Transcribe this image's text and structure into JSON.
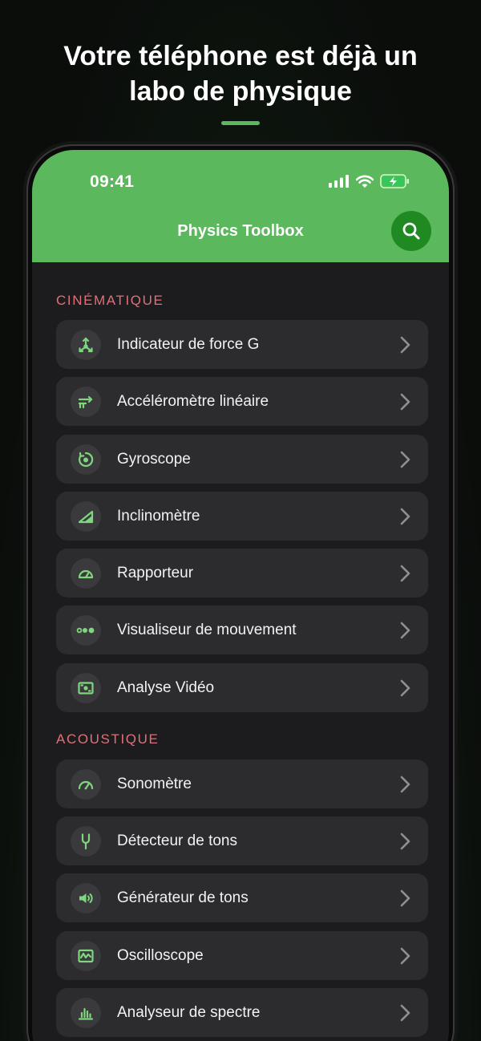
{
  "headline": {
    "line1": "Votre téléphone est déjà un",
    "line2": "labo de physique"
  },
  "colors": {
    "accent": "#5cb85c",
    "accent_dark": "#1f8a22",
    "section_title": "#e0707a",
    "icon_green": "#7fd67f"
  },
  "status_bar": {
    "time": "09:41"
  },
  "app": {
    "title": "Physics Toolbox"
  },
  "sections": [
    {
      "title": "CINÉMATIQUE",
      "items": [
        {
          "label": "Indicateur de force G",
          "icon": "g-force-icon"
        },
        {
          "label": "Accéléromètre linéaire",
          "icon": "linear-accelerometer-icon"
        },
        {
          "label": "Gyroscope",
          "icon": "gyroscope-icon"
        },
        {
          "label": "Inclinomètre",
          "icon": "inclinometer-icon"
        },
        {
          "label": "Rapporteur",
          "icon": "protractor-icon"
        },
        {
          "label": "Visualiseur de mouvement",
          "icon": "motion-visualizer-icon"
        },
        {
          "label": "Analyse Vidéo",
          "icon": "video-analysis-icon"
        }
      ]
    },
    {
      "title": "ACOUSTIQUE",
      "items": [
        {
          "label": "Sonomètre",
          "icon": "sound-meter-icon"
        },
        {
          "label": "Détecteur de tons",
          "icon": "tuning-fork-icon"
        },
        {
          "label": "Générateur de tons",
          "icon": "speaker-icon"
        },
        {
          "label": "Oscilloscope",
          "icon": "oscilloscope-icon"
        },
        {
          "label": "Analyseur de spectre",
          "icon": "spectrum-analyzer-icon"
        }
      ]
    }
  ]
}
